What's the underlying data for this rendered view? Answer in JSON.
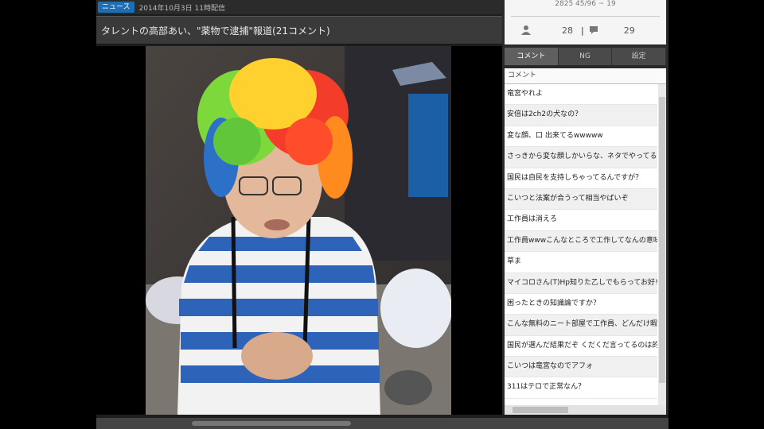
{
  "header": {
    "badge": "ニュース",
    "meta": "2014年10月3日 11時配信"
  },
  "title": "タレントの高部あい、\"薬物で逮捕\"報道(21コメント)",
  "stats": {
    "counter": "2825 45/96 ~ 19",
    "viewers": "28",
    "comments": "29"
  },
  "tabs": [
    "コメント",
    "NG",
    "設定"
  ],
  "comment_list": {
    "header": "コメント",
    "items": [
      "竜宮やれよ",
      "安倍は2ch2の犬なの？",
      "変な顔、口 出来てるwwwww",
      "さっきから変な顔しかいらな、ネタでやってるのか？",
      "国民は自民を支持しちゃってるんですが？",
      "こいつと法案が合うって相当やばいぞ",
      "工作員は消えろ",
      "工作員wwwこんなところで工作してなんの意味が",
      "草ま",
      "マイコロさん(T)Hp知りた乙しでもらってお好を御",
      "困ったときの知識論ですか？",
      "こんな無料のニート部屋で工作員、どんだけ暇な",
      "国民が選んだ結果だぞ くだくだ言ってるのは的",
      "こいつは竜宮なのでアフォ",
      "311はテロで正常なん？"
    ]
  },
  "colors": {
    "accent": "#1d6fb5",
    "panel_bg": "#2a2a2a"
  }
}
